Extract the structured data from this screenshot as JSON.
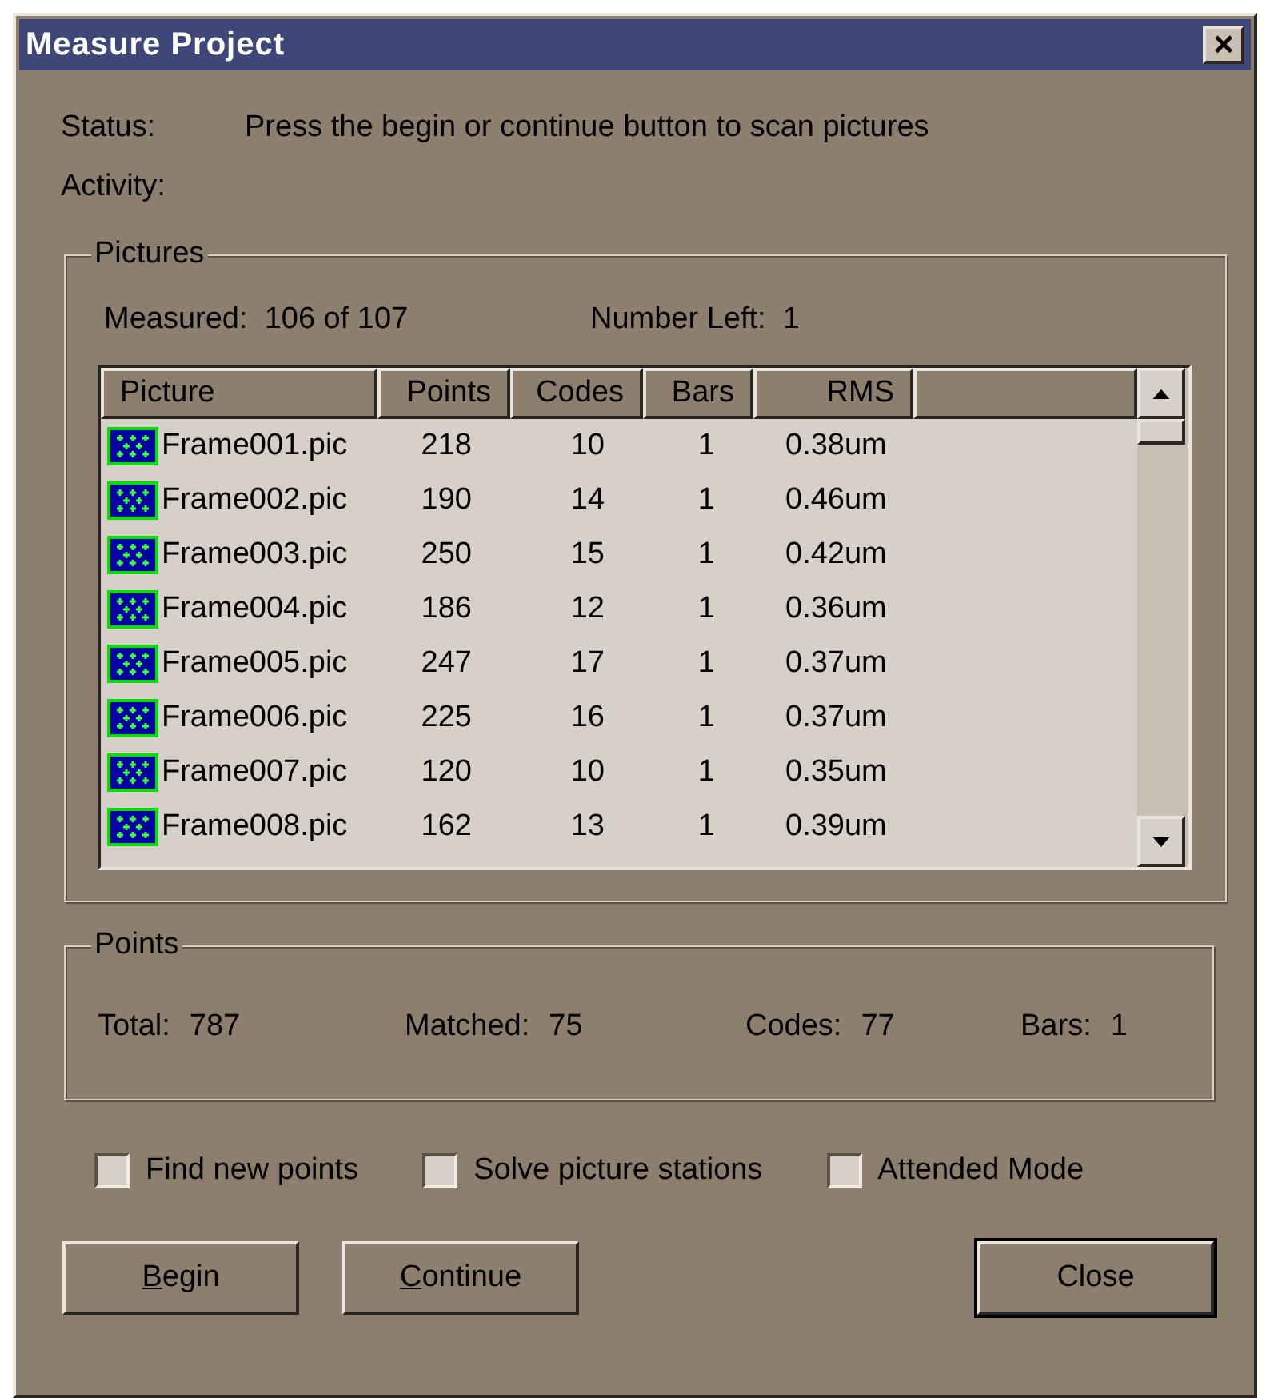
{
  "window": {
    "title": "Measure Project",
    "close_glyph": "×"
  },
  "status": {
    "label": "Status:",
    "value": "Press the begin or continue button to scan pictures"
  },
  "activity": {
    "label": "Activity:"
  },
  "pictures": {
    "title": "Pictures",
    "measured": "Measured:  106 of 107",
    "number_left": "Number Left:  1",
    "table": {
      "columns": [
        "Picture",
        "Points",
        "Codes",
        "Bars",
        "RMS"
      ],
      "rows": [
        {
          "picture": "Frame001.pic",
          "points": "218",
          "codes": "10",
          "bars": "1",
          "rms": "0.38um"
        },
        {
          "picture": "Frame002.pic",
          "points": "190",
          "codes": "14",
          "bars": "1",
          "rms": "0.46um"
        },
        {
          "picture": "Frame003.pic",
          "points": "250",
          "codes": "15",
          "bars": "1",
          "rms": "0.42um"
        },
        {
          "picture": "Frame004.pic",
          "points": "186",
          "codes": "12",
          "bars": "1",
          "rms": "0.36um"
        },
        {
          "picture": "Frame005.pic",
          "points": "247",
          "codes": "17",
          "bars": "1",
          "rms": "0.37um"
        },
        {
          "picture": "Frame006.pic",
          "points": "225",
          "codes": "16",
          "bars": "1",
          "rms": "0.37um"
        },
        {
          "picture": "Frame007.pic",
          "points": "120",
          "codes": "10",
          "bars": "1",
          "rms": "0.35um"
        },
        {
          "picture": "Frame008.pic",
          "points": "162",
          "codes": "13",
          "bars": "1",
          "rms": "0.39um"
        }
      ]
    }
  },
  "points": {
    "title": "Points",
    "stats": [
      {
        "label": "Total:",
        "value": "787"
      },
      {
        "label": "Matched:",
        "value": "75"
      },
      {
        "label": "Codes:",
        "value": "77"
      },
      {
        "label": "Bars:",
        "value": "1"
      }
    ]
  },
  "options": [
    {
      "label": "Find new points",
      "checked": false
    },
    {
      "label": "Solve picture stations",
      "checked": false
    },
    {
      "label": "Attended Mode",
      "checked": false
    }
  ],
  "buttons": [
    {
      "label": "Begin",
      "underline_first": true,
      "default": false
    },
    {
      "label": "Continue",
      "underline_first": true,
      "default": false
    },
    {
      "label": "Close",
      "underline_first": false,
      "default": true
    }
  ]
}
